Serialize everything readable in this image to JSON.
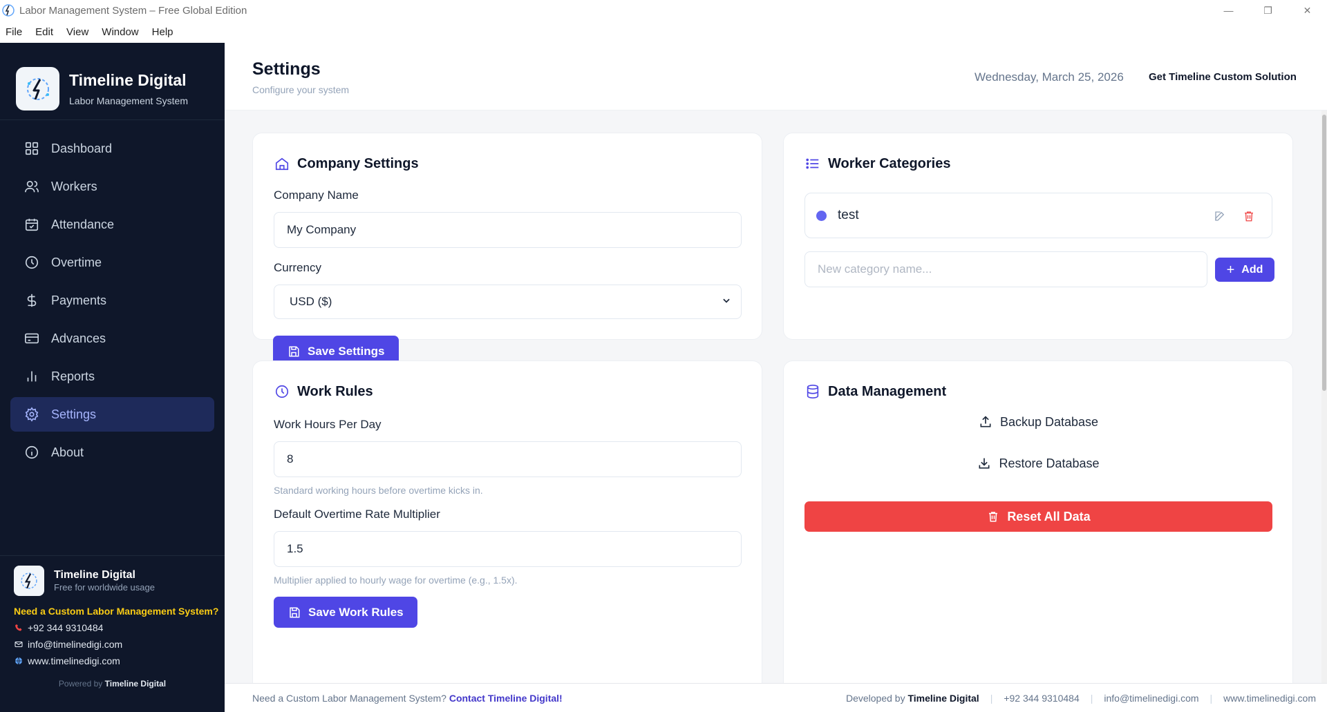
{
  "window": {
    "title": "Labor Management System – Free Global Edition",
    "minimize": "—",
    "restore": "❐",
    "close": "✕"
  },
  "menu": [
    "File",
    "Edit",
    "View",
    "Window",
    "Help"
  ],
  "sidebar": {
    "brand_title": "Timeline Digital",
    "brand_sub": "Labor Management System",
    "items": [
      {
        "label": "Dashboard",
        "icon": "dashboard-icon"
      },
      {
        "label": "Workers",
        "icon": "workers-icon"
      },
      {
        "label": "Attendance",
        "icon": "calendar-icon"
      },
      {
        "label": "Overtime",
        "icon": "clock-icon"
      },
      {
        "label": "Payments",
        "icon": "dollar-icon"
      },
      {
        "label": "Advances",
        "icon": "card-icon"
      },
      {
        "label": "Reports",
        "icon": "bar-chart-icon"
      },
      {
        "label": "Settings",
        "icon": "gear-icon",
        "active": true
      },
      {
        "label": "About",
        "icon": "info-icon"
      }
    ],
    "footer": {
      "title": "Timeline Digital",
      "sub": "Free for worldwide usage",
      "cta": "Need a Custom Labor Management System?",
      "phone": "+92 344 9310484",
      "email": "info@timelinedigi.com",
      "web": "www.timelinedigi.com",
      "powered_prefix": "Powered by",
      "powered_name": "Timeline Digital"
    }
  },
  "header": {
    "title": "Settings",
    "subtitle": "Configure your system",
    "date": "Wednesday, March 25, 2026",
    "link": "Get Timeline Custom Solution"
  },
  "company_settings": {
    "title": "Company Settings",
    "name_label": "Company Name",
    "name_value": "My Company",
    "currency_label": "Currency",
    "currency_value": "USD ($)",
    "save_label": "Save Settings"
  },
  "worker_categories": {
    "title": "Worker Categories",
    "items": [
      {
        "name": "test",
        "color": "#6366f1"
      }
    ],
    "new_placeholder": "New category name...",
    "add_label": "Add"
  },
  "work_rules": {
    "title": "Work Rules",
    "hours_label": "Work Hours Per Day",
    "hours_value": "8",
    "hours_hint": "Standard working hours before overtime kicks in.",
    "rate_label": "Default Overtime Rate Multiplier",
    "rate_value": "1.5",
    "rate_hint": "Multiplier applied to hourly wage for overtime (e.g., 1.5x).",
    "save_label": "Save Work Rules"
  },
  "data_management": {
    "title": "Data Management",
    "backup_label": "Backup Database",
    "restore_label": "Restore Database",
    "reset_label": "Reset All Data"
  },
  "footer": {
    "left_text": "Need a Custom Labor Management System?",
    "left_link": "Contact Timeline Digital!",
    "dev_prefix": "Developed by",
    "dev_name": "Timeline Digital",
    "phone": "+92 344 9310484",
    "email": "info@timelinedigi.com",
    "web": "www.timelinedigi.com"
  },
  "colors": {
    "sidebar_bg": "#0f172a",
    "accent": "#4f46e5",
    "danger": "#ef4444",
    "cta": "#facc15"
  }
}
